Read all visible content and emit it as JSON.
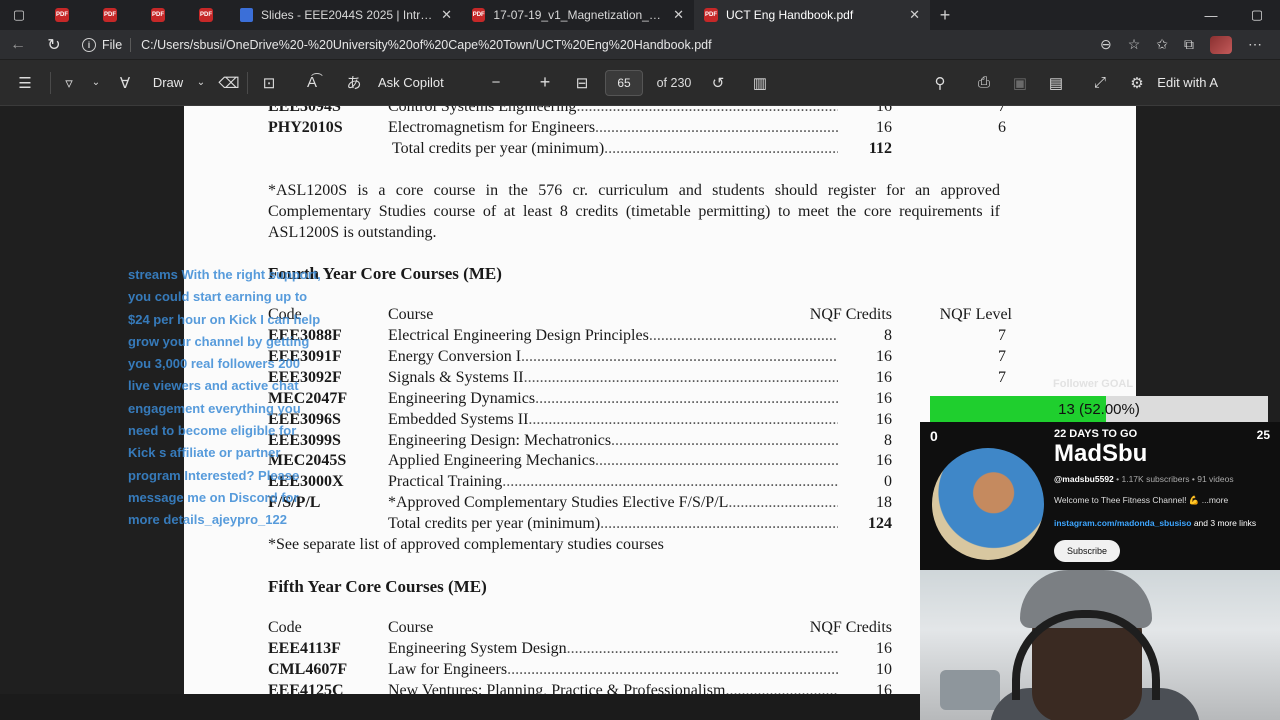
{
  "tabs": [
    {
      "title": "Slides - EEE2044S 2025 | Introduc",
      "active": false
    },
    {
      "title": "17-07-19_v1_Magnetization_Hyst",
      "active": false
    },
    {
      "title": "UCT Eng Handbook.pdf",
      "active": true
    }
  ],
  "address": {
    "scheme": "File",
    "url": "C:/Users/sbusi/OneDrive%20-%20University%20of%20Cape%20Town/UCT%20Eng%20Handbook.pdf"
  },
  "toolbar": {
    "draw_label": "Draw",
    "copilot_label": "Ask Copilot",
    "page_current": "65",
    "page_total": "of 230",
    "edit_label": "Edit with A"
  },
  "doc": {
    "top_rows": [
      {
        "code": "EEE3094S",
        "course": "Control Systems Engineering",
        "credits": "16",
        "level": "7"
      },
      {
        "code": "PHY2010S",
        "course": "Electromagnetism for Engineers",
        "credits": "16",
        "level": "6"
      }
    ],
    "top_total": {
      "course": "Total credits per year (minimum)",
      "credits": "112"
    },
    "note_para": "*ASL1200S is a core course in the 576 cr. curriculum and students should register for an approved Complementary Studies course of at least 8 credits (timetable permitting) to meet the core requirements if ASL1200S is outstanding.",
    "fourth_title": "Fourth Year Core Courses (ME)",
    "headers": {
      "code": "Code",
      "course": "Course",
      "credits": "NQF Credits",
      "level": "NQF Level",
      "level_cut": "N"
    },
    "fourth_rows": [
      {
        "code": "EEE3088F",
        "course": "Electrical Engineering Design Principles",
        "credits": "8",
        "level": "7"
      },
      {
        "code": "EEE3091F",
        "course": "Energy Conversion I",
        "credits": "16",
        "level": "7"
      },
      {
        "code": "EEE3092F",
        "course": "Signals & Systems II",
        "credits": "16",
        "level": "7"
      },
      {
        "code": "MEC2047F",
        "course": "Engineering Dynamics",
        "credits": "16",
        "level": ""
      },
      {
        "code": "EEE3096S",
        "course": "Embedded Systems II",
        "credits": "16",
        "level": ""
      },
      {
        "code": "EEE3099S",
        "course": "Engineering Design: Mechatronics",
        "credits": "8",
        "level": ""
      },
      {
        "code": "MEC2045S",
        "course": "Applied Engineering Mechanics",
        "credits": "16",
        "level": ""
      },
      {
        "code": "EEE3000X",
        "course": "Practical Training",
        "credits": "0",
        "level": ""
      },
      {
        "code": "F/S/P/L",
        "course": "*Approved Complementary Studies Elective F/S/P/L",
        "credits": "18",
        "level": ""
      }
    ],
    "fourth_total": {
      "course": "Total credits per year (minimum)",
      "credits": "124"
    },
    "see_note": "*See separate list of approved complementary studies courses",
    "fifth_title": "Fifth Year Core Courses (ME)",
    "fifth_rows": [
      {
        "code": "EEE4113F",
        "course": "Engineering System Design",
        "credits": "16"
      },
      {
        "code": "CML4607F",
        "course": "Law for Engineers",
        "credits": "10"
      },
      {
        "code": "EEE4125C",
        "course": "New Ventures: Planning, Practice & Professionalism",
        "credits": "16"
      }
    ]
  },
  "chat_overlay": {
    "text": "streams With the right support, you could start earning up to $24 per hour on Kick I can help grow your channel by getting you 3,000 real followers 200 live viewers and active chat engagement everything you need to become eligible for Kick s affiliate or partner program Interested? Please message me on Discord for more details_ajeypro_122"
  },
  "goal": {
    "title": "Follower GOAL",
    "progress_text": "13 (52.00%)",
    "progress_fraction": 0.52,
    "min": "0",
    "max": "25",
    "days_left": "22 DAYS TO GO",
    "fill_color": "#1fcf2e"
  },
  "channel": {
    "name": "MadSbu",
    "handle": "@madsbu5592",
    "meta": " • 1.17K subscribers • 91 videos",
    "desc": "Welcome to Thee Fitness Channel! 💪 ...more",
    "link": "instagram.com/madonda_sbusiso",
    "link_more": " and 3 more links",
    "subscribe": "Subscribe"
  }
}
